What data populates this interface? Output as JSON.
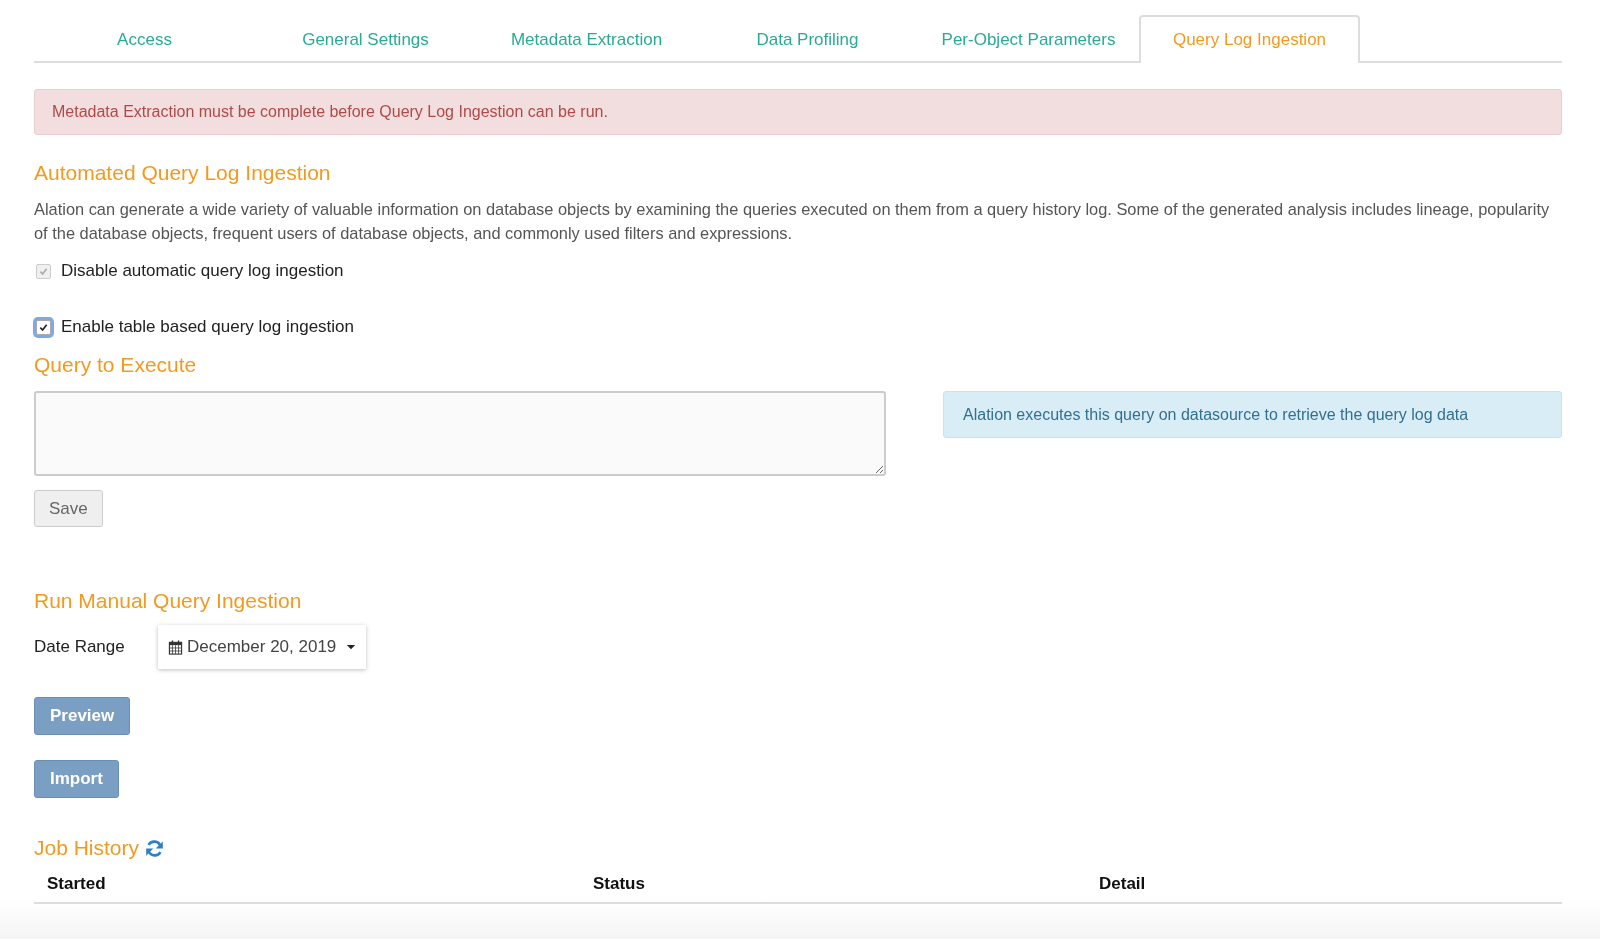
{
  "tabs": [
    {
      "label": "Access",
      "selected": false
    },
    {
      "label": "General Settings",
      "selected": false
    },
    {
      "label": "Metadata Extraction",
      "selected": false
    },
    {
      "label": "Data Profiling",
      "selected": false
    },
    {
      "label": "Per-Object Parameters",
      "selected": false
    },
    {
      "label": "Query Log Ingestion",
      "selected": true
    }
  ],
  "alert": "Metadata Extraction must be complete before Query Log Ingestion can be run.",
  "automated": {
    "title": "Automated Query Log Ingestion",
    "description": "Alation can generate a wide variety of valuable information on database objects by examining the queries executed on them from a query history log. Some of the generated analysis includes lineage, popularity of the database objects, frequent users of database objects, and commonly used filters and expressions.",
    "options": [
      {
        "label": "Disable automatic query log ingestion",
        "checked": true,
        "disabled": true
      },
      {
        "label": "Enable table based query log ingestion",
        "checked": true,
        "disabled": false
      }
    ]
  },
  "query": {
    "title": "Query to Execute",
    "info": "Alation executes this query on datasource to retrieve the query log data",
    "save": "Save"
  },
  "manual": {
    "title": "Run Manual Query Ingestion",
    "date_label": "Date Range",
    "date_value": "December 20, 2019",
    "buttons": [
      "Preview",
      "Import"
    ]
  },
  "job_history": {
    "title": "Job History",
    "columns": [
      "Started",
      "Status",
      "Detail"
    ]
  }
}
